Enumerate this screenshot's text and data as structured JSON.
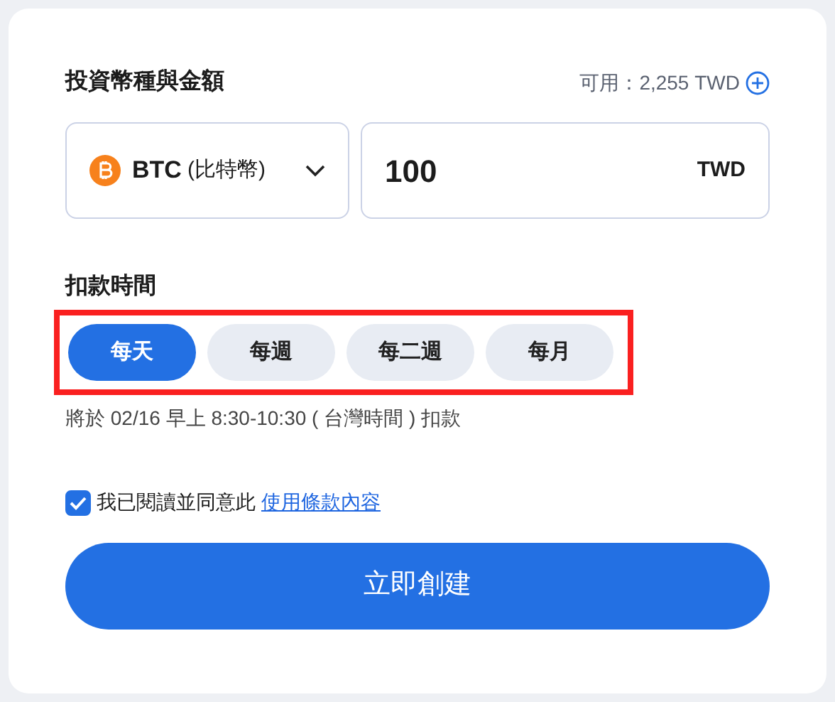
{
  "amount_section": {
    "title": "投資幣種與金額",
    "available": "可用：2,255 TWD",
    "currency": {
      "symbol": "BTC",
      "name": "(比特幣)"
    },
    "amount": {
      "value": "100",
      "unit": "TWD"
    }
  },
  "schedule": {
    "title": "扣款時間",
    "highlighted": true,
    "options": [
      {
        "label": "每天",
        "selected": true
      },
      {
        "label": "每週",
        "selected": false
      },
      {
        "label": "每二週",
        "selected": false
      },
      {
        "label": "每月",
        "selected": false
      }
    ],
    "note": "將於 02/16 早上 8:30-10:30 ( 台灣時間 ) 扣款"
  },
  "agreement": {
    "checked": true,
    "text": "我已閱讀並同意此",
    "link": "使用條款內容"
  },
  "submit": "立即創建"
}
